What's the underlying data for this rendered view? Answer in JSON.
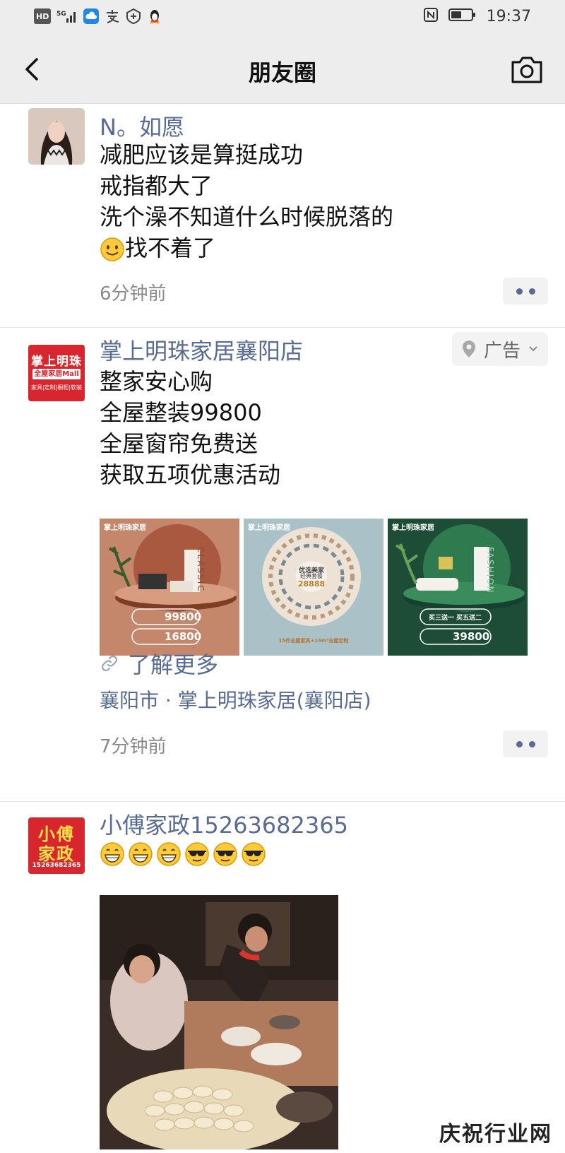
{
  "status_bar": {
    "left_icons": [
      "HD",
      "5G"
    ],
    "time": "19:37"
  },
  "nav": {
    "title": "朋友圈"
  },
  "posts": [
    {
      "name": "N。如愿",
      "lines": [
        "减肥应该是算挺成功",
        "戒指都大了",
        "洗个澡不知道什么时候脱落的",
        "找不着了"
      ],
      "time": "6分钟前"
    },
    {
      "name": "掌上明珠家居襄阳店",
      "avatar_brand": "掌上明珠",
      "avatar_sub": "全屋家居Mall",
      "avatar_tags": "家具|定制|橱柜|软装",
      "ad_label": "广告",
      "lines": [
        "整家安心购",
        "全屋整装99800",
        "全屋窗帘免费送",
        "获取五项优惠活动"
      ],
      "images": [
        {
          "brand": "掌上明珠家居",
          "side": "CLASSIC",
          "price1": "99800",
          "price2": "16800"
        },
        {
          "brand": "掌上明珠家居",
          "center1": "优选美家",
          "center2": "经典套餐",
          "center3": "28888",
          "footer": "15件全屋家具+15m²全屋定制"
        },
        {
          "brand": "掌上明珠家居",
          "side": "FASHION",
          "tag1": "买三送一 买五送二",
          "price1": "39800"
        }
      ],
      "link_text": "了解更多",
      "location": "襄阳市 · 掌上明珠家居(襄阳店)",
      "time": "7分钟前"
    },
    {
      "name": "小傅家政15263682365",
      "avatar_line1": "小傅",
      "avatar_line2": "家政",
      "avatar_phone": "15263682365"
    }
  ],
  "watermark": "庆祝行业网"
}
